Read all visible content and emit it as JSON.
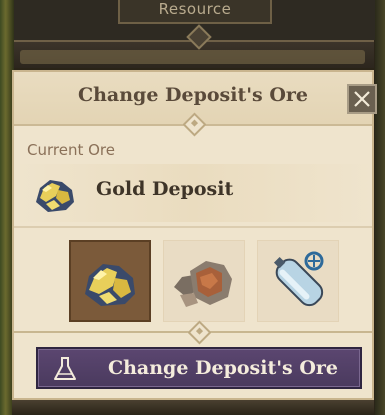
{
  "background": {
    "tab_label": "Resource"
  },
  "dialog": {
    "title": "Change Deposit's Ore",
    "close_icon": "close-icon",
    "current_label": "Current Ore",
    "current_ore": {
      "name": "Gold Deposit",
      "icon": "gold-ore-icon"
    },
    "options": [
      {
        "icon": "gold-ore-icon",
        "selected": true
      },
      {
        "icon": "copper-ore-icon",
        "selected": false
      },
      {
        "icon": "gas-canister-icon",
        "selected": false
      }
    ],
    "action_button": {
      "label": "Change Deposit's Ore",
      "icon": "flask-icon"
    }
  },
  "colors": {
    "panel": "#efe4cd",
    "title_text": "#5a4a3a",
    "button": "#4a3a5e",
    "selected_slot": "#7b5a3a"
  }
}
